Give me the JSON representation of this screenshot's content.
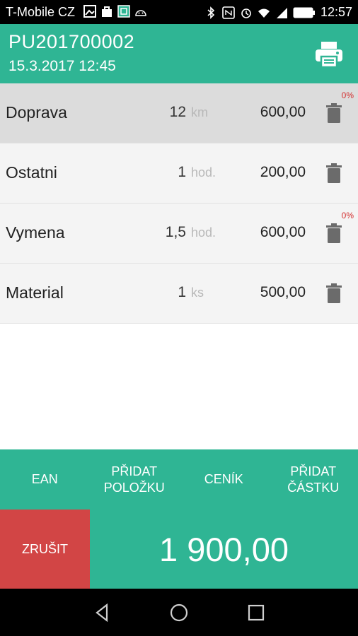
{
  "status_bar": {
    "carrier": "T-Mobile CZ",
    "time": "12:57"
  },
  "header": {
    "document_id": "PU201700002",
    "datetime": "15.3.2017 12:45",
    "print_icon": "printer-icon"
  },
  "items": [
    {
      "name": "Doprava",
      "qty": "12",
      "unit": "km",
      "price": "600,00",
      "discount": "0%",
      "selected": true
    },
    {
      "name": "Ostatni",
      "qty": "1",
      "unit": "hod.",
      "price": "200,00",
      "discount": "",
      "selected": false
    },
    {
      "name": "Vymena",
      "qty": "1,5",
      "unit": "hod.",
      "price": "600,00",
      "discount": "0%",
      "selected": false
    },
    {
      "name": "Material",
      "qty": "1",
      "unit": "ks",
      "price": "500,00",
      "discount": "",
      "selected": false
    }
  ],
  "actions": {
    "ean": "EAN",
    "add_item": "PŘIDAT\nPOLOŽKU",
    "price_list": "CENÍK",
    "add_amount": "PŘIDAT\nČÁSTKU"
  },
  "footer": {
    "cancel": "ZRUŠIT",
    "total": "1 900,00"
  },
  "colors": {
    "primary": "#2fb594",
    "cancel": "#d24545",
    "discount": "#d32f2f"
  }
}
